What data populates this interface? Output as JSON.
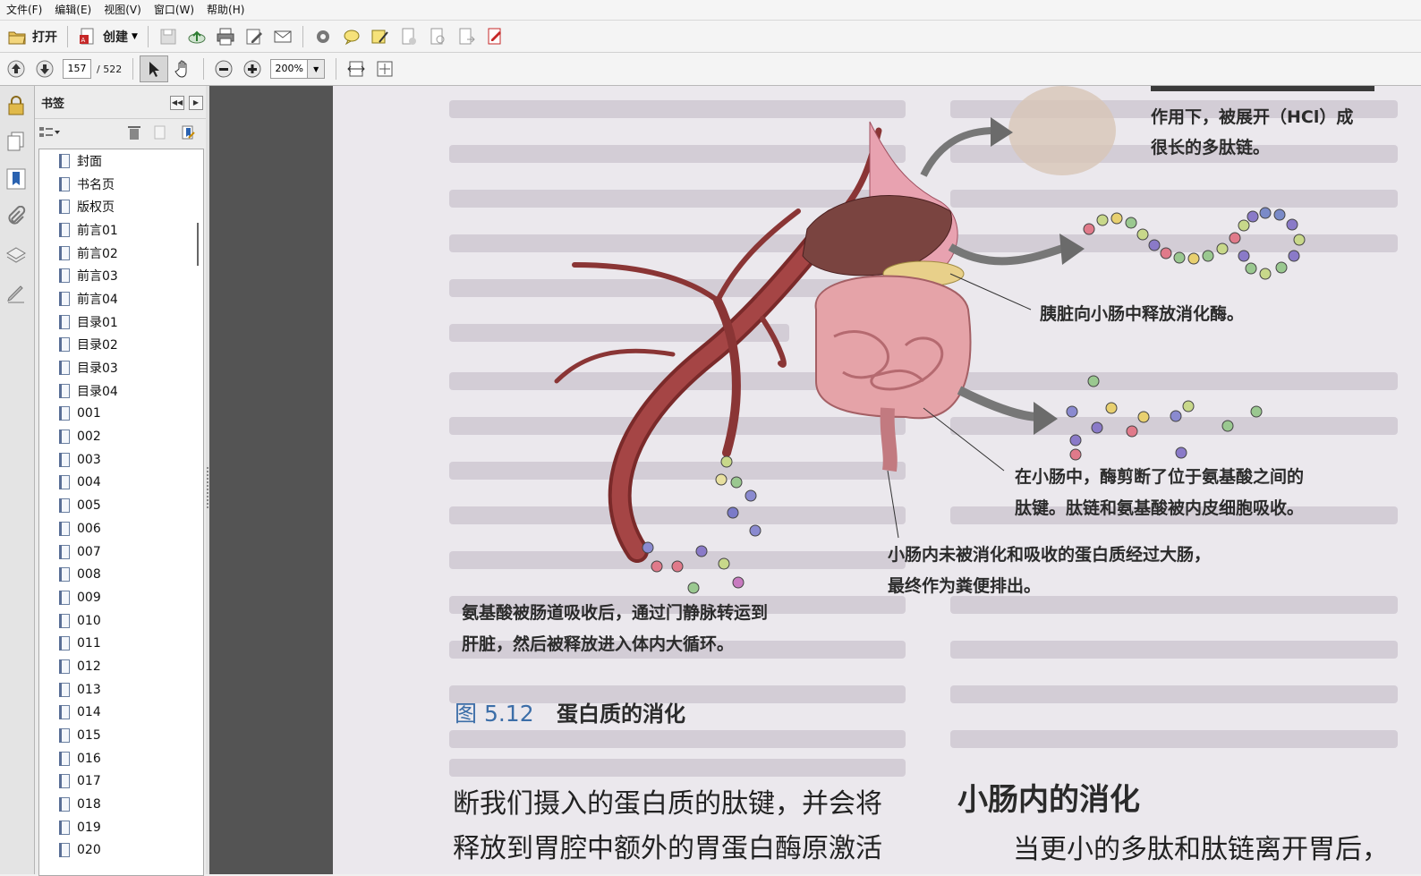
{
  "menu": [
    "文件(F)",
    "编辑(E)",
    "视图(V)",
    "窗口(W)",
    "帮助(H)"
  ],
  "toolbar": {
    "open_label": "打开",
    "create_label": "创建"
  },
  "nav": {
    "current_page": "157",
    "total_pages": "/ 522",
    "zoom": "200%"
  },
  "bookmarks": {
    "title": "书签",
    "items": [
      "封面",
      "书名页",
      "版权页",
      "前言01",
      "前言02",
      "前言03",
      "前言04",
      "目录01",
      "目录02",
      "目录03",
      "目录04",
      "001",
      "002",
      "003",
      "004",
      "005",
      "006",
      "007",
      "008",
      "009",
      "010",
      "011",
      "012",
      "013",
      "014",
      "015",
      "016",
      "017",
      "018",
      "019",
      "020"
    ]
  },
  "figure": {
    "cap_top_1": "作用下，被展开（HCl）成",
    "cap_top_2": "很长的多肽链。",
    "cap_pancreas": "胰脏向小肠中释放消化酶。",
    "cap_small_1": "在小肠中，酶剪断了位于氨基酸之间的",
    "cap_small_2": "肽键。肽链和氨基酸被内皮细胞吸收。",
    "cap_large_1": "小肠内未被消化和吸收的蛋白质经过大肠，",
    "cap_large_2": "最终作为粪便排出。",
    "cap_portal_1": "氨基酸被肠道吸收后，通过门静脉转运到",
    "cap_portal_2": "肝脏，然后被释放进入体内大循环。",
    "number": "图 5.12",
    "title": "蛋白质的消化"
  },
  "body": {
    "line1": "断我们摄入的蛋白质的肽键，并会将",
    "line2": "释放到胃腔中额外的胃蛋白酶原激活",
    "section_heading": "小肠内的消化",
    "section_line1": "当更小的多肽和肽链离开胃后，"
  }
}
